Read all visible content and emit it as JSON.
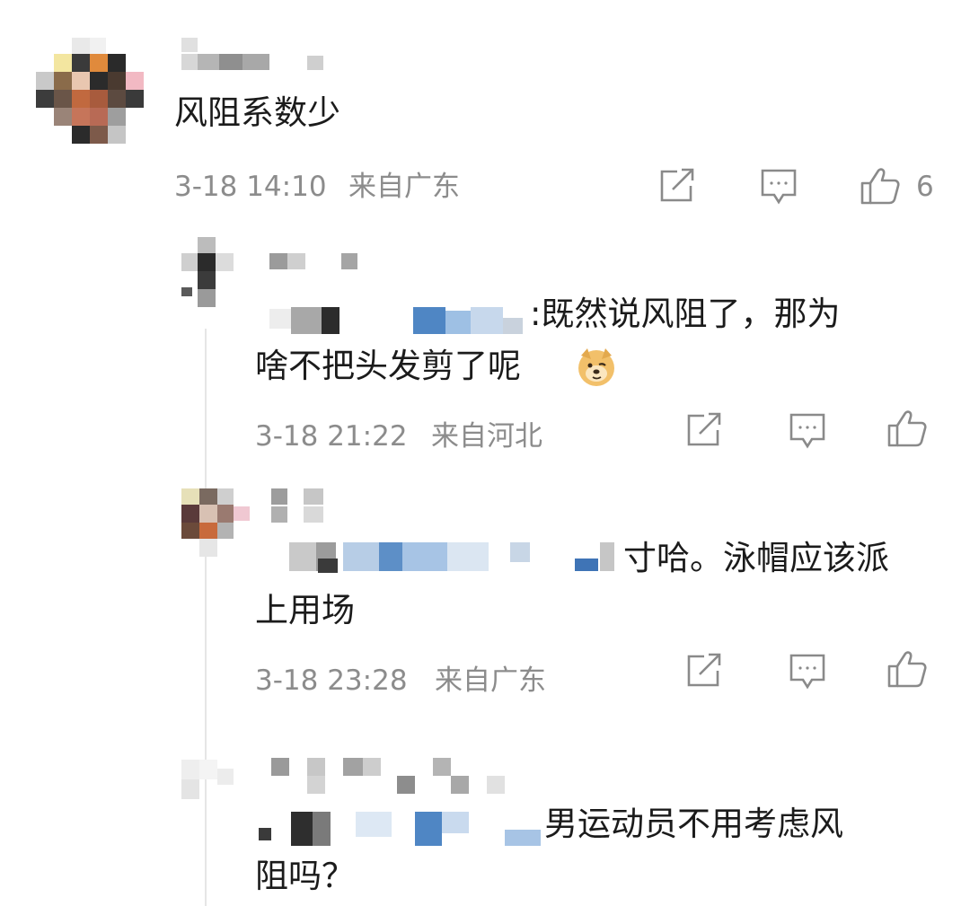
{
  "comment": {
    "text": "风阻系数少",
    "time": "3-18 14:10",
    "location": "来自广东",
    "like_count": "6"
  },
  "replies": [
    {
      "text_line1": ":既然说风阻了，那为",
      "text_line2": "啥不把头发剪了呢",
      "emoji": "doge-emoji",
      "time": "3-18 21:22",
      "location": "来自河北"
    },
    {
      "text_line1": "寸哈。泳帽应该派",
      "text_line2": "上用场",
      "time": "3-18 23:28",
      "location": "来自广东"
    },
    {
      "text_line1": "男运动员不用考虑风",
      "text_line2": "阻吗？"
    }
  ],
  "icons": {
    "share": "share-icon",
    "comment": "comment-icon",
    "like": "thumbs-up-icon"
  },
  "colors": {
    "text": "#1b1b1b",
    "meta": "#8c8c8c",
    "icon": "#8a8a8a",
    "thread_line": "#e6e6e6"
  }
}
